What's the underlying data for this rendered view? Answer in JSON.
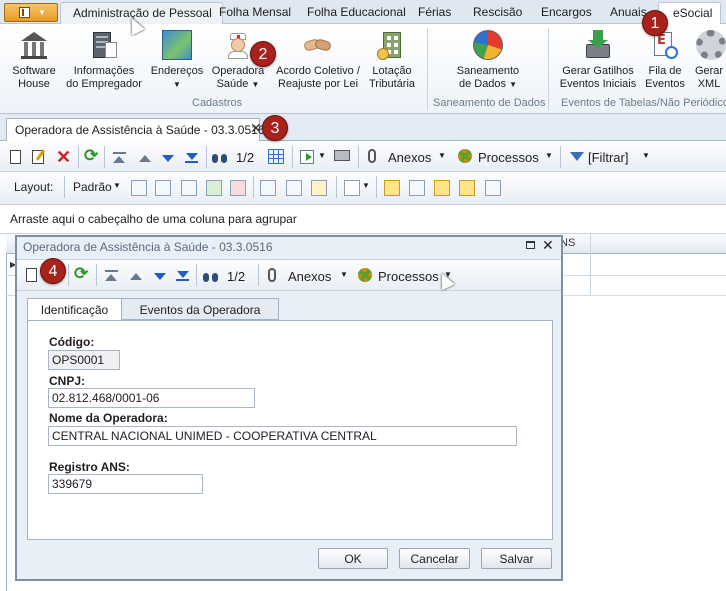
{
  "ribbon": {
    "tabs": [
      "Administração de Pessoal",
      "Folha Mensal",
      "Folha Educacional",
      "Férias",
      "Rescisão",
      "Encargos",
      "Anuais",
      "eSocial"
    ],
    "groups": {
      "cadastros": {
        "label": "Cadastros",
        "buttons": [
          {
            "line1": "Software",
            "line2": "House",
            "icon": "building-columns-icon"
          },
          {
            "line1": "Informações",
            "line2": "do Empregador",
            "icon": "server-icon"
          },
          {
            "line1": "Endereços",
            "line2": "",
            "icon": "map-icon"
          },
          {
            "line1": "Operadora",
            "line2": "Saúde",
            "icon": "nurse-icon"
          },
          {
            "line1": "Acordo Coletivo /",
            "line2": "Reajuste por Lei",
            "icon": "handshake-icon"
          },
          {
            "line1": "Lotação",
            "line2": "Tributária",
            "icon": "office-building-icon"
          }
        ]
      },
      "saneamento": {
        "label": "Saneamento de Dados",
        "buttons": [
          {
            "line1": "Saneamento",
            "line2": "de Dados",
            "icon": "pie-chart-icon"
          }
        ]
      },
      "eventos": {
        "label": "Eventos de Tabelas/Não Periódicos",
        "buttons": [
          {
            "line1": "Gerar Gatilhos",
            "line2": "Eventos Iniciais",
            "icon": "download-icon"
          },
          {
            "line1": "Fila de",
            "line2": "Eventos",
            "icon": "event-queue-icon"
          },
          {
            "line1": "Gerar",
            "line2": "XML",
            "icon": "gear-icon"
          }
        ]
      }
    }
  },
  "document_tab": {
    "title": "Operadora de Assistência à Saúde - 03.3.0516",
    "close": "✕"
  },
  "main_toolbar": {
    "page": "1/2",
    "anexos": "Anexos",
    "processos": "Processos",
    "filtrar": "[Filtrar]"
  },
  "layout_toolbar": {
    "layout_label": "Layout:",
    "padrao": "Padrão"
  },
  "grid": {
    "group_hint": "Arraste aqui o cabeçalho de uma coluna para agrupar",
    "visible_column": "NS"
  },
  "dialog": {
    "title": "Operadora de Assistência à Saúde - 03.3.0516",
    "toolbar": {
      "page": "1/2",
      "anexos": "Anexos",
      "processos": "Processos"
    },
    "tabs": [
      "Identificação",
      "Eventos da Operadora"
    ],
    "fields": {
      "codigo": {
        "label": "Código:",
        "value": "OPS0001"
      },
      "cnpj": {
        "label": "CNPJ:",
        "value": "02.812.468/0001-06"
      },
      "nome": {
        "label": "Nome da Operadora:",
        "value": "CENTRAL NACIONAL UNIMED - COOPERATIVA CENTRAL"
      },
      "registro": {
        "label": "Registro ANS:",
        "value": "339679"
      }
    },
    "buttons": {
      "ok": "OK",
      "cancel": "Cancelar",
      "save": "Salvar"
    }
  },
  "callouts": [
    "1",
    "2",
    "3",
    "4"
  ],
  "colors": {
    "callout": "#a6221b",
    "active_tool": "#ffe48a",
    "ribbon_bg": "#dfe7f1"
  }
}
